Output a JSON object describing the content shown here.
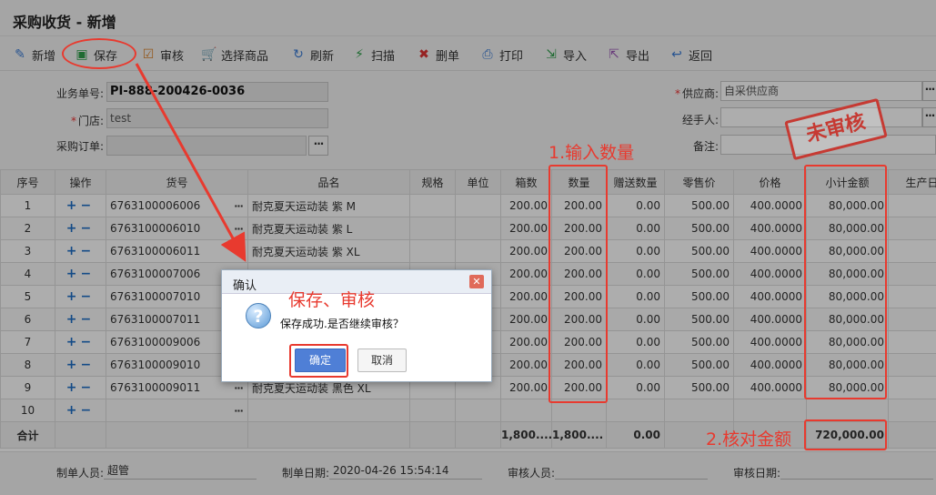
{
  "window": {
    "title": "采购收货 - 新增"
  },
  "toolbar": [
    {
      "label": "新增",
      "icon": "new-icon",
      "glyph": "✎",
      "color": "#3a7bd5"
    },
    {
      "label": "保存",
      "icon": "save-icon",
      "glyph": "▣",
      "color": "#2e9e4a"
    },
    {
      "label": "审核",
      "icon": "check-icon",
      "glyph": "☑",
      "color": "#d9822b"
    },
    {
      "label": "选择商品",
      "icon": "cart-icon",
      "glyph": "🛒",
      "color": "#3a7bd5"
    },
    {
      "label": "刷新",
      "icon": "refresh-icon",
      "glyph": "↻",
      "color": "#3a7bd5"
    },
    {
      "label": "扫描",
      "icon": "scan-icon",
      "glyph": "⚡",
      "color": "#2e9e4a"
    },
    {
      "label": "删单",
      "icon": "delete-icon",
      "glyph": "✖",
      "color": "#d33"
    },
    {
      "label": "打印",
      "icon": "print-icon",
      "glyph": "⎙",
      "color": "#3a7bd5"
    },
    {
      "label": "导入",
      "icon": "import-icon",
      "glyph": "⇲",
      "color": "#2e9e4a"
    },
    {
      "label": "导出",
      "icon": "export-icon",
      "glyph": "⇱",
      "color": "#9b59b6"
    },
    {
      "label": "返回",
      "icon": "back-icon",
      "glyph": "↩",
      "color": "#3a7bd5"
    }
  ],
  "form": {
    "order_no_label": "业务单号:",
    "order_no": "PI-888-200426-0036",
    "store_label": "门店:",
    "store": "test",
    "po_label": "采购订单:",
    "po": "",
    "supplier_label": "供应商:",
    "supplier": "自采供应商",
    "handler_label": "经手人:",
    "handler": "",
    "remark_label": "备注:",
    "remark": "",
    "dots": "···"
  },
  "grid": {
    "headers": [
      "序号",
      "操作",
      "货号",
      "品名",
      "规格",
      "单位",
      "箱数",
      "数量",
      "赠送数量",
      "零售价",
      "价格",
      "小计金额",
      "生产日"
    ],
    "rows": [
      {
        "no": "1",
        "sku": "6763100006006",
        "name": "耐克夏天运动装 紫 M",
        "boxes": "200.00",
        "qty": "200.00",
        "gift": "0.00",
        "retail": "500.00",
        "price": "400.0000",
        "subtotal": "80,000.00"
      },
      {
        "no": "2",
        "sku": "6763100006010",
        "name": "耐克夏天运动装 紫 L",
        "boxes": "200.00",
        "qty": "200.00",
        "gift": "0.00",
        "retail": "500.00",
        "price": "400.0000",
        "subtotal": "80,000.00"
      },
      {
        "no": "3",
        "sku": "6763100006011",
        "name": "耐克夏天运动装 紫 XL",
        "boxes": "200.00",
        "qty": "200.00",
        "gift": "0.00",
        "retail": "500.00",
        "price": "400.0000",
        "subtotal": "80,000.00"
      },
      {
        "no": "4",
        "sku": "6763100007006",
        "name": "",
        "boxes": "200.00",
        "qty": "200.00",
        "gift": "0.00",
        "retail": "500.00",
        "price": "400.0000",
        "subtotal": "80,000.00"
      },
      {
        "no": "5",
        "sku": "6763100007010",
        "name": "",
        "boxes": "200.00",
        "qty": "200.00",
        "gift": "0.00",
        "retail": "500.00",
        "price": "400.0000",
        "subtotal": "80,000.00"
      },
      {
        "no": "6",
        "sku": "6763100007011",
        "name": "",
        "boxes": "200.00",
        "qty": "200.00",
        "gift": "0.00",
        "retail": "500.00",
        "price": "400.0000",
        "subtotal": "80,000.00"
      },
      {
        "no": "7",
        "sku": "6763100009006",
        "name": "",
        "boxes": "200.00",
        "qty": "200.00",
        "gift": "0.00",
        "retail": "500.00",
        "price": "400.0000",
        "subtotal": "80,000.00"
      },
      {
        "no": "8",
        "sku": "6763100009010",
        "name": "",
        "boxes": "200.00",
        "qty": "200.00",
        "gift": "0.00",
        "retail": "500.00",
        "price": "400.0000",
        "subtotal": "80,000.00"
      },
      {
        "no": "9",
        "sku": "6763100009011",
        "name": "耐克夏天运动装 黑色 XL",
        "boxes": "200.00",
        "qty": "200.00",
        "gift": "0.00",
        "retail": "500.00",
        "price": "400.0000",
        "subtotal": "80,000.00"
      },
      {
        "no": "10",
        "sku": "",
        "name": "",
        "boxes": "",
        "qty": "",
        "gift": "",
        "retail": "",
        "price": "",
        "subtotal": ""
      }
    ],
    "total": {
      "label": "合计",
      "boxes": "1,800....",
      "qty": "1,800....",
      "gift": "0.00",
      "subtotal": "720,000.00"
    }
  },
  "footer": {
    "maker_label": "制单人员:",
    "maker": "超管",
    "make_date_label": "制单日期:",
    "make_date": "2020-04-26 15:54:14",
    "auditor_label": "审核人员:",
    "auditor": "",
    "audit_date_label": "审核日期:",
    "audit_date": ""
  },
  "dialog": {
    "title": "确认",
    "message": "保存成功.是否继续审核？",
    "ok": "确定",
    "cancel": "取消",
    "icon": "question-icon",
    "close_glyph": "✕"
  },
  "annotations": {
    "step1": "1.输入数量",
    "step2": "2.核对金额",
    "save_audit": "保存、审核",
    "stamp": "未审核",
    "color": "#e83a2f"
  }
}
